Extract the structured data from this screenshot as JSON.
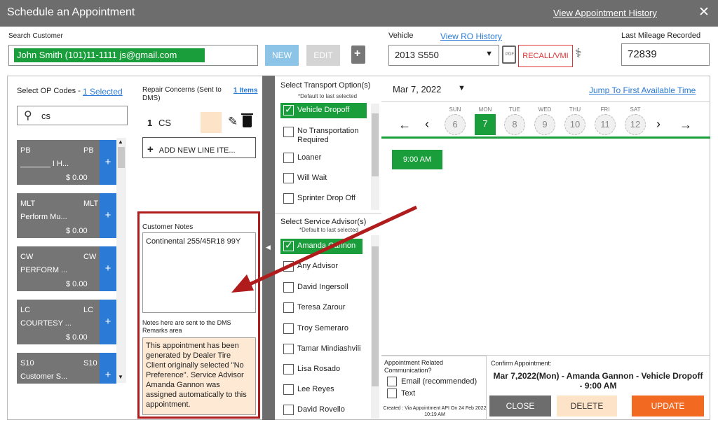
{
  "titlebar": {
    "title": "Schedule an Appointment",
    "history_link": "View Appointment History",
    "close_glyph": "✕"
  },
  "customer": {
    "label": "Search Customer",
    "value": "John Smith (101)11-1111 js@gmail.com",
    "new_label": "NEW",
    "edit_label": "EDIT"
  },
  "vehicle": {
    "label": "Vehicle",
    "ro_link": "View RO History",
    "selected": "2013 S550",
    "recall_label": "RECALL/VMI"
  },
  "mileage": {
    "label": "Last Mileage Recorded",
    "value": "72839"
  },
  "op_codes": {
    "header": "Select OP Codes -",
    "selected_link": "1 Selected",
    "search_value": "cs",
    "cards": [
      {
        "code": "PB",
        "code_right": "PB",
        "desc": "_______ I H...",
        "price": "$ 0.00"
      },
      {
        "code": "MLT",
        "code_right": "MLT",
        "desc": "Perform Mu...",
        "price": "$ 0.00"
      },
      {
        "code": "CW",
        "code_right": "CW",
        "desc": "PERFORM ...",
        "price": "$ 0.00"
      },
      {
        "code": "LC",
        "code_right": "LC",
        "desc": "COURTESY ...",
        "price": "$ 0.00"
      },
      {
        "code": "S10",
        "code_right": "S10",
        "desc": "Customer S...",
        "price": ""
      }
    ]
  },
  "repair": {
    "header": "Repair Concerns (Sent to DMS)",
    "items_link": "1 Items",
    "line_number": "1",
    "line_code": "CS",
    "add_line": "ADD NEW LINE ITE..."
  },
  "notes": {
    "customer_label": "Customer Notes",
    "customer_value": "Continental 255/45R18 99Y",
    "dms_label": "Notes here are sent to the DMS Remarks area",
    "dms_value": "This appointment has been generated by Dealer Tire Client originally selected \"No Preference\". Service Advisor Amanda Gannon was assigned automatically to this appointment."
  },
  "transport": {
    "header": "Select Transport Option(s)",
    "sub": "*Default to last selected",
    "options": [
      "Vehicle Dropoff",
      "No Transportation Required",
      "Loaner",
      "Will Wait",
      "Sprinter Drop Off"
    ]
  },
  "advisors": {
    "header": "Select Service Advisor(s)",
    "sub": "*Default to last selected",
    "options": [
      "Amanda Gannon",
      "Any Advisor",
      "David Ingersoll",
      "Teresa Zarour",
      "Troy Semeraro",
      "Tamar Mindiashvili",
      "Lisa Rosado",
      "Lee Reyes",
      "David Rovello"
    ]
  },
  "calendar": {
    "date": "Mar 7, 2022",
    "jump_link": "Jump To First Available Time",
    "days": [
      {
        "name": "SUN",
        "num": "6"
      },
      {
        "name": "MON",
        "num": "7"
      },
      {
        "name": "TUE",
        "num": "8"
      },
      {
        "name": "WED",
        "num": "9"
      },
      {
        "name": "THU",
        "num": "10"
      },
      {
        "name": "FRI",
        "num": "11"
      },
      {
        "name": "SAT",
        "num": "12"
      }
    ],
    "time_slot": "9:00 AM"
  },
  "communication": {
    "header": "Appointment Related Communication?",
    "email": "Email (recommended)",
    "text": "Text",
    "created": "Created : Via Appointment API On 24 Feb 2022 10:19 AM"
  },
  "confirm": {
    "label": "Confirm Appointment:",
    "text": "Mar 7,2022(Mon) - Amanda Gannon - Vehicle Dropoff - 9:00 AM",
    "close": "CLOSE",
    "delete": "DELETE",
    "update": "UPDATE"
  },
  "colors": {
    "green": "#1a9d3b",
    "blue": "#2b7bd6",
    "orange": "#f26a21",
    "peach": "#fde4c8",
    "annotation_red": "#b01c1c"
  }
}
